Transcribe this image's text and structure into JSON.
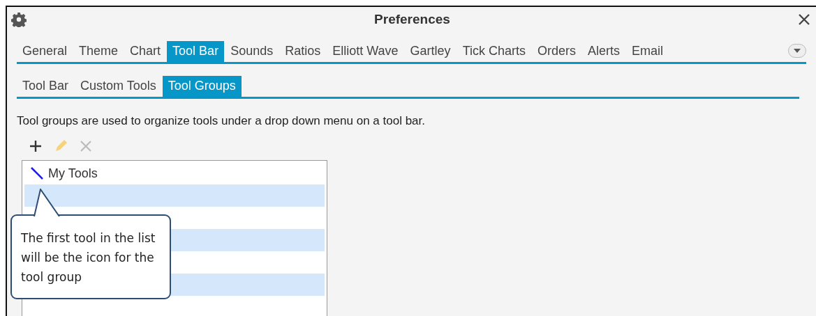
{
  "window": {
    "title": "Preferences"
  },
  "tabs": [
    {
      "label": "General",
      "selected": false
    },
    {
      "label": "Theme",
      "selected": false
    },
    {
      "label": "Chart",
      "selected": false
    },
    {
      "label": "Tool Bar",
      "selected": true
    },
    {
      "label": "Sounds",
      "selected": false
    },
    {
      "label": "Ratios",
      "selected": false
    },
    {
      "label": "Elliott Wave",
      "selected": false
    },
    {
      "label": "Gartley",
      "selected": false
    },
    {
      "label": "Tick Charts",
      "selected": false
    },
    {
      "label": "Orders",
      "selected": false
    },
    {
      "label": "Alerts",
      "selected": false
    },
    {
      "label": "Email",
      "selected": false
    }
  ],
  "subtabs": [
    {
      "label": "Tool Bar",
      "selected": false
    },
    {
      "label": "Custom Tools",
      "selected": false
    },
    {
      "label": "Tool Groups",
      "selected": true
    }
  ],
  "description": "Tool groups are used to organize tools under a drop down menu on a tool bar.",
  "toolbar": [
    {
      "kind": "add",
      "disabled": false
    },
    {
      "kind": "edit",
      "disabled": true
    },
    {
      "kind": "delete",
      "disabled": true
    }
  ],
  "groups": [
    {
      "label": "My Tools"
    }
  ],
  "callout": {
    "text": "The first tool in the list will be the icon for the tool group"
  }
}
